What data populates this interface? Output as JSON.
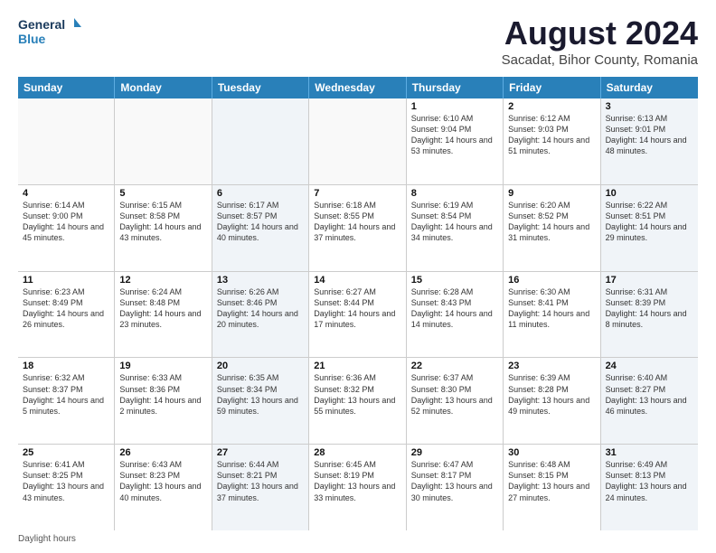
{
  "header": {
    "logo_line1": "General",
    "logo_line2": "Blue",
    "month_year": "August 2024",
    "location": "Sacadat, Bihor County, Romania"
  },
  "weekdays": [
    "Sunday",
    "Monday",
    "Tuesday",
    "Wednesday",
    "Thursday",
    "Friday",
    "Saturday"
  ],
  "weeks": [
    [
      {
        "day": "",
        "info": "",
        "shaded": false
      },
      {
        "day": "",
        "info": "",
        "shaded": false
      },
      {
        "day": "",
        "info": "",
        "shaded": true
      },
      {
        "day": "",
        "info": "",
        "shaded": false
      },
      {
        "day": "1",
        "info": "Sunrise: 6:10 AM\nSunset: 9:04 PM\nDaylight: 14 hours\nand 53 minutes.",
        "shaded": false
      },
      {
        "day": "2",
        "info": "Sunrise: 6:12 AM\nSunset: 9:03 PM\nDaylight: 14 hours\nand 51 minutes.",
        "shaded": false
      },
      {
        "day": "3",
        "info": "Sunrise: 6:13 AM\nSunset: 9:01 PM\nDaylight: 14 hours\nand 48 minutes.",
        "shaded": true
      }
    ],
    [
      {
        "day": "4",
        "info": "Sunrise: 6:14 AM\nSunset: 9:00 PM\nDaylight: 14 hours\nand 45 minutes.",
        "shaded": false
      },
      {
        "day": "5",
        "info": "Sunrise: 6:15 AM\nSunset: 8:58 PM\nDaylight: 14 hours\nand 43 minutes.",
        "shaded": false
      },
      {
        "day": "6",
        "info": "Sunrise: 6:17 AM\nSunset: 8:57 PM\nDaylight: 14 hours\nand 40 minutes.",
        "shaded": true
      },
      {
        "day": "7",
        "info": "Sunrise: 6:18 AM\nSunset: 8:55 PM\nDaylight: 14 hours\nand 37 minutes.",
        "shaded": false
      },
      {
        "day": "8",
        "info": "Sunrise: 6:19 AM\nSunset: 8:54 PM\nDaylight: 14 hours\nand 34 minutes.",
        "shaded": false
      },
      {
        "day": "9",
        "info": "Sunrise: 6:20 AM\nSunset: 8:52 PM\nDaylight: 14 hours\nand 31 minutes.",
        "shaded": false
      },
      {
        "day": "10",
        "info": "Sunrise: 6:22 AM\nSunset: 8:51 PM\nDaylight: 14 hours\nand 29 minutes.",
        "shaded": true
      }
    ],
    [
      {
        "day": "11",
        "info": "Sunrise: 6:23 AM\nSunset: 8:49 PM\nDaylight: 14 hours\nand 26 minutes.",
        "shaded": false
      },
      {
        "day": "12",
        "info": "Sunrise: 6:24 AM\nSunset: 8:48 PM\nDaylight: 14 hours\nand 23 minutes.",
        "shaded": false
      },
      {
        "day": "13",
        "info": "Sunrise: 6:26 AM\nSunset: 8:46 PM\nDaylight: 14 hours\nand 20 minutes.",
        "shaded": true
      },
      {
        "day": "14",
        "info": "Sunrise: 6:27 AM\nSunset: 8:44 PM\nDaylight: 14 hours\nand 17 minutes.",
        "shaded": false
      },
      {
        "day": "15",
        "info": "Sunrise: 6:28 AM\nSunset: 8:43 PM\nDaylight: 14 hours\nand 14 minutes.",
        "shaded": false
      },
      {
        "day": "16",
        "info": "Sunrise: 6:30 AM\nSunset: 8:41 PM\nDaylight: 14 hours\nand 11 minutes.",
        "shaded": false
      },
      {
        "day": "17",
        "info": "Sunrise: 6:31 AM\nSunset: 8:39 PM\nDaylight: 14 hours\nand 8 minutes.",
        "shaded": true
      }
    ],
    [
      {
        "day": "18",
        "info": "Sunrise: 6:32 AM\nSunset: 8:37 PM\nDaylight: 14 hours\nand 5 minutes.",
        "shaded": false
      },
      {
        "day": "19",
        "info": "Sunrise: 6:33 AM\nSunset: 8:36 PM\nDaylight: 14 hours\nand 2 minutes.",
        "shaded": false
      },
      {
        "day": "20",
        "info": "Sunrise: 6:35 AM\nSunset: 8:34 PM\nDaylight: 13 hours\nand 59 minutes.",
        "shaded": true
      },
      {
        "day": "21",
        "info": "Sunrise: 6:36 AM\nSunset: 8:32 PM\nDaylight: 13 hours\nand 55 minutes.",
        "shaded": false
      },
      {
        "day": "22",
        "info": "Sunrise: 6:37 AM\nSunset: 8:30 PM\nDaylight: 13 hours\nand 52 minutes.",
        "shaded": false
      },
      {
        "day": "23",
        "info": "Sunrise: 6:39 AM\nSunset: 8:28 PM\nDaylight: 13 hours\nand 49 minutes.",
        "shaded": false
      },
      {
        "day": "24",
        "info": "Sunrise: 6:40 AM\nSunset: 8:27 PM\nDaylight: 13 hours\nand 46 minutes.",
        "shaded": true
      }
    ],
    [
      {
        "day": "25",
        "info": "Sunrise: 6:41 AM\nSunset: 8:25 PM\nDaylight: 13 hours\nand 43 minutes.",
        "shaded": false
      },
      {
        "day": "26",
        "info": "Sunrise: 6:43 AM\nSunset: 8:23 PM\nDaylight: 13 hours\nand 40 minutes.",
        "shaded": false
      },
      {
        "day": "27",
        "info": "Sunrise: 6:44 AM\nSunset: 8:21 PM\nDaylight: 13 hours\nand 37 minutes.",
        "shaded": true
      },
      {
        "day": "28",
        "info": "Sunrise: 6:45 AM\nSunset: 8:19 PM\nDaylight: 13 hours\nand 33 minutes.",
        "shaded": false
      },
      {
        "day": "29",
        "info": "Sunrise: 6:47 AM\nSunset: 8:17 PM\nDaylight: 13 hours\nand 30 minutes.",
        "shaded": false
      },
      {
        "day": "30",
        "info": "Sunrise: 6:48 AM\nSunset: 8:15 PM\nDaylight: 13 hours\nand 27 minutes.",
        "shaded": false
      },
      {
        "day": "31",
        "info": "Sunrise: 6:49 AM\nSunset: 8:13 PM\nDaylight: 13 hours\nand 24 minutes.",
        "shaded": true
      }
    ]
  ],
  "footer": {
    "note": "Daylight hours"
  }
}
